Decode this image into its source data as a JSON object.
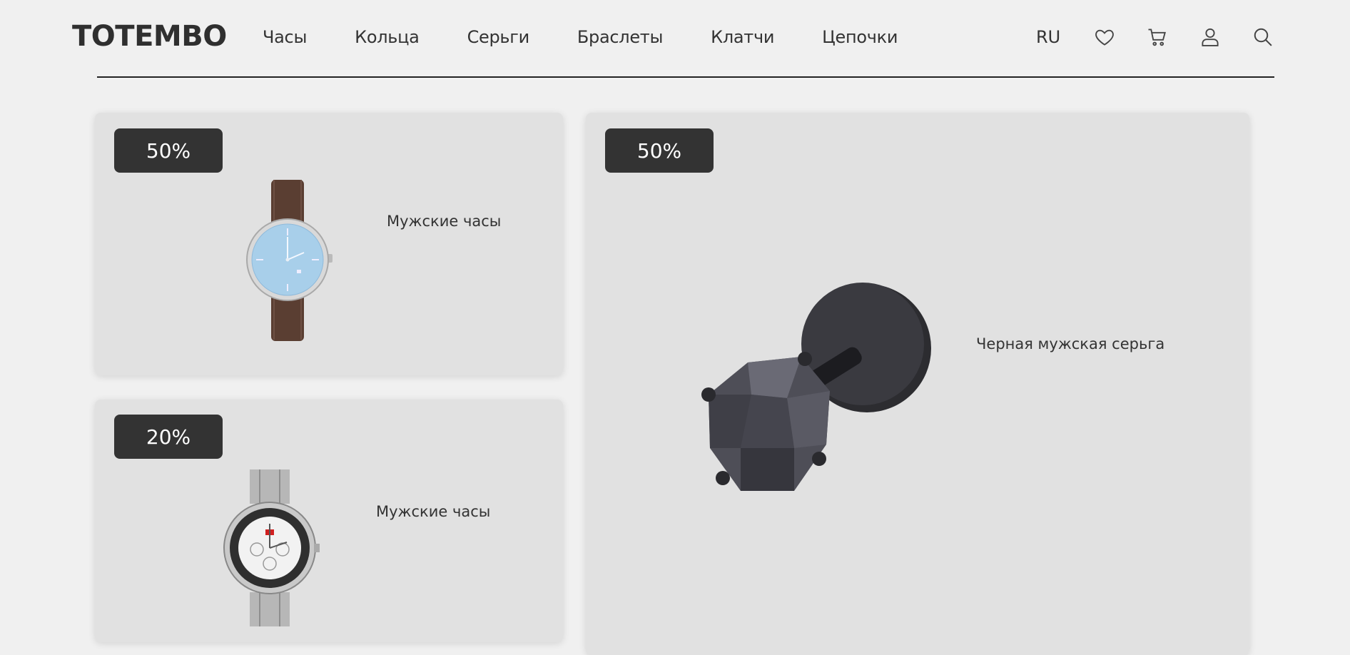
{
  "header": {
    "logo": "TOTEMBO",
    "nav": [
      "Часы",
      "Кольца",
      "Серьги",
      "Браслеты",
      "Клатчи",
      "Цепочки"
    ],
    "lang": "RU",
    "icons": [
      "heart-icon",
      "cart-icon",
      "user-icon",
      "search-icon"
    ]
  },
  "products": [
    {
      "discount": "50%",
      "name": "Мужские часы",
      "image": "brown-leather-watch"
    },
    {
      "discount": "20%",
      "name": "Мужские часы",
      "image": "steel-chronograph-watch"
    },
    {
      "discount": "50%",
      "name": "Черная мужская серьга",
      "image": "black-stud-earring"
    }
  ],
  "colors": {
    "background": "#f0f0f0",
    "card": "#e1e1e1",
    "badge": "#333333",
    "badge_text": "#ffffff"
  }
}
